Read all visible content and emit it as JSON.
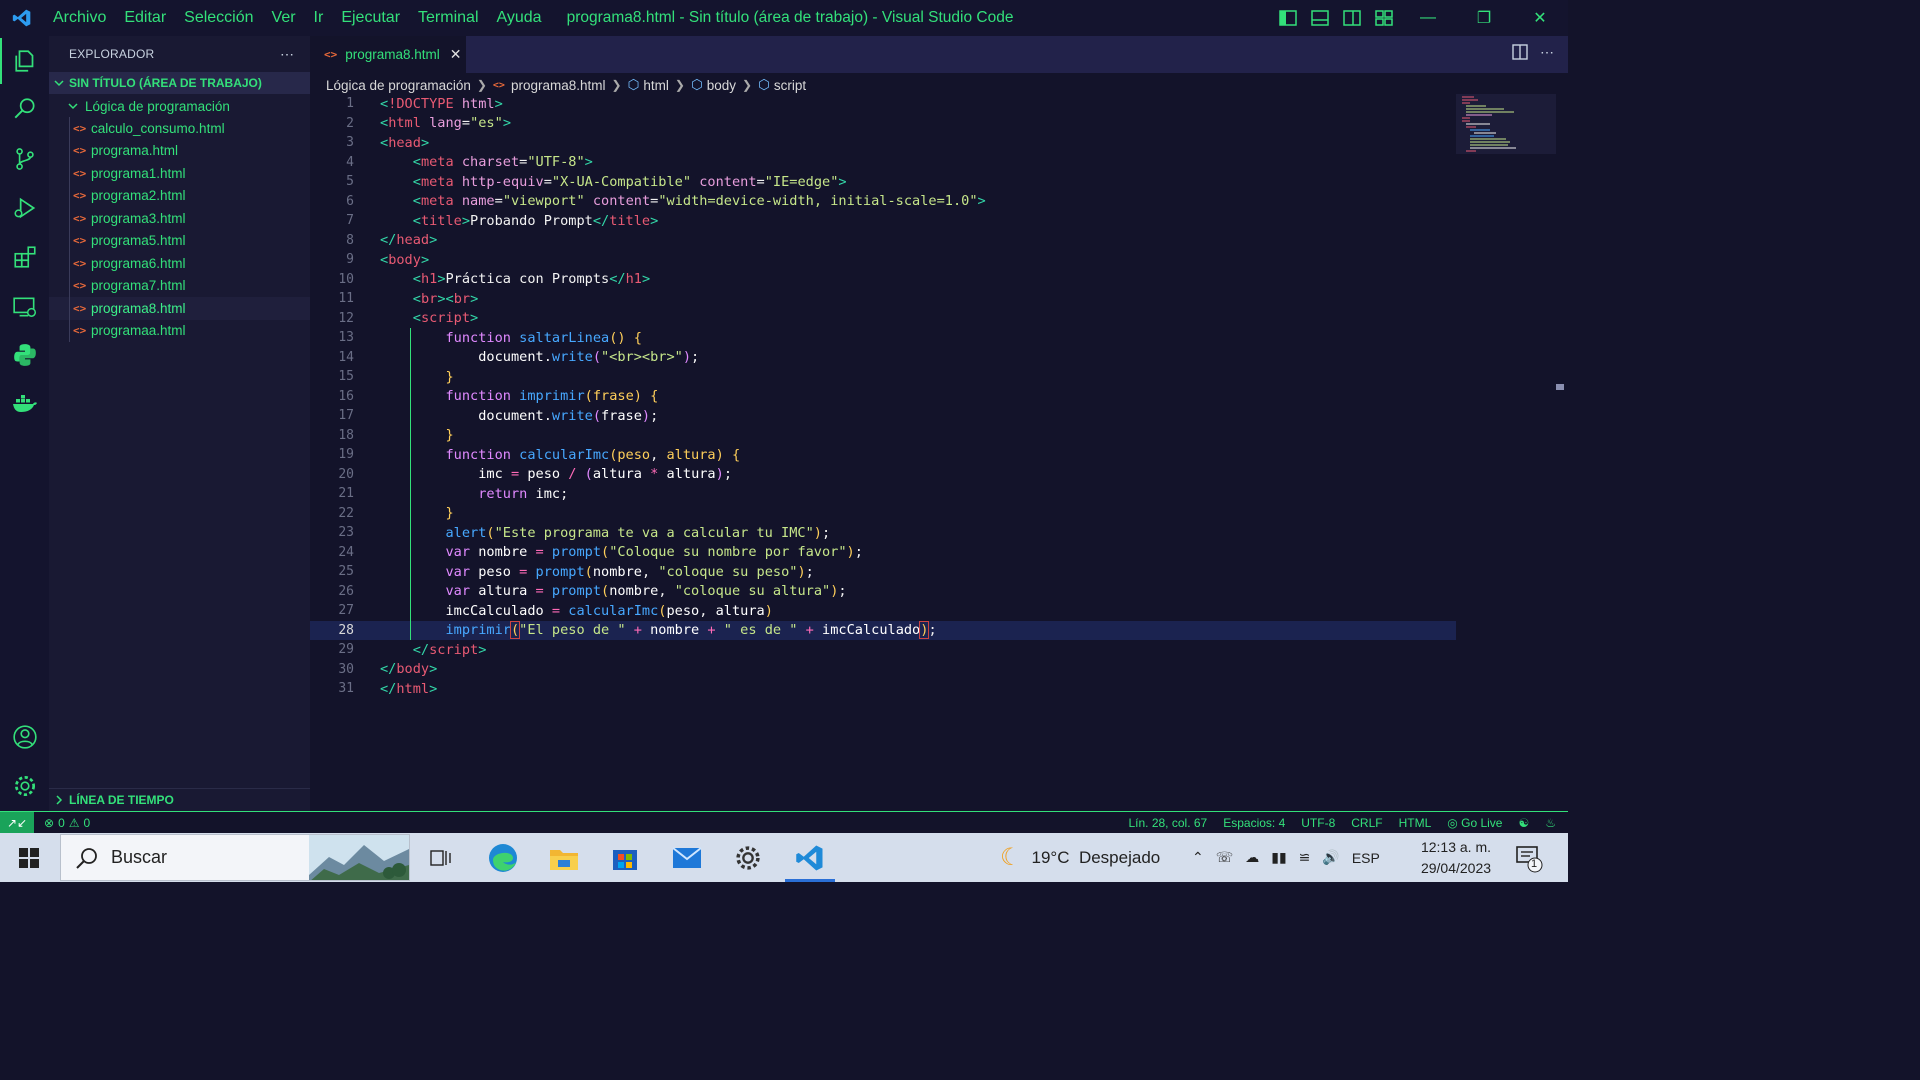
{
  "titlebar": {
    "menu": [
      "Archivo",
      "Editar",
      "Selección",
      "Ver",
      "Ir",
      "Ejecutar",
      "Terminal",
      "Ayuda"
    ],
    "window_title": "programa8.html - Sin título (área de trabajo) - Visual Studio Code"
  },
  "sidebar": {
    "header": "EXPLORADOR",
    "workspace": "SIN TÍTULO (ÁREA DE TRABAJO)",
    "folder": "Lógica de programación",
    "files": [
      "calculo_consumo.html",
      "programa.html",
      "programa1.html",
      "programa2.html",
      "programa3.html",
      "programa5.html",
      "programa6.html",
      "programa7.html",
      "programa8.html",
      "programaa.html"
    ],
    "selected_file": "programa8.html",
    "timeline": "LÍNEA DE TIEMPO"
  },
  "editor": {
    "tab_label": "programa8.html",
    "breadcrumb": [
      "Lógica de programación",
      "programa8.html",
      "html",
      "body",
      "script"
    ],
    "current_line": 28,
    "line_numbers": [
      "1",
      "2",
      "3",
      "4",
      "5",
      "6",
      "7",
      "8",
      "9",
      "10",
      "11",
      "12",
      "13",
      "14",
      "15",
      "16",
      "17",
      "18",
      "19",
      "20",
      "21",
      "22",
      "23",
      "24",
      "25",
      "26",
      "27",
      "28",
      "29",
      "30",
      "31"
    ]
  },
  "status": {
    "errors": "0",
    "warnings": "0",
    "position": "Lín. 28, col. 67",
    "spaces": "Espacios: 4",
    "encoding": "UTF-8",
    "eol": "CRLF",
    "language": "HTML",
    "golive": "Go Live"
  },
  "taskbar": {
    "search_placeholder": "Buscar",
    "weather": "19°C  Despejado",
    "lang": "ESP",
    "time": "12:13 a. m.",
    "date": "29/04/2023",
    "notif_count": "1"
  },
  "colors": {
    "accent": "#33e07a",
    "background": "#13132a",
    "sidebar": "#191933",
    "html_icon": "#e8693a"
  }
}
